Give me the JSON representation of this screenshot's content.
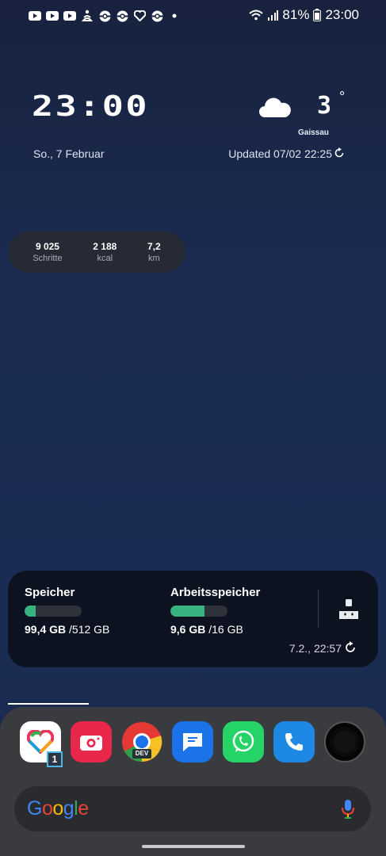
{
  "status_bar": {
    "notification_icons": [
      "youtube-icon",
      "youtube-icon",
      "youtube-icon",
      "meditation-icon",
      "pokemon-icon",
      "pokemon-icon",
      "heart-pulse-icon",
      "pokemon-icon",
      "dot-icon"
    ],
    "battery": "81%",
    "time": "23:00"
  },
  "clock_widget": {
    "time": "23:00",
    "date": "So., 7 Februar",
    "temperature": "3",
    "degree": "°",
    "location": "Gaissau",
    "updated": "Updated 07/02 22:25"
  },
  "health_widget": {
    "stats": [
      {
        "value": "9 025",
        "label": "Schritte"
      },
      {
        "value": "2 188",
        "label": "kcal"
      },
      {
        "value": "7,2",
        "label": "km"
      }
    ]
  },
  "storage_widget": {
    "storage": {
      "title": "Speicher",
      "used": "99,4 GB",
      "total": "/512 GB",
      "fraction": 0.19
    },
    "ram": {
      "title": "Arbeitsspeicher",
      "used": "9,6 GB",
      "total": "/16 GB",
      "fraction": 0.6
    },
    "timestamp": "7.2., 22:57"
  },
  "dock": {
    "apps": [
      "health-app-icon",
      "camera-app-icon",
      "chrome-dev-app-icon",
      "messages-app-icon",
      "whatsapp-app-icon",
      "phone-app-icon",
      "camera-shortcut-icon"
    ],
    "health_badge": "1",
    "chrome_badge": "DEV",
    "search_logo": "Google"
  },
  "colors": {
    "accent_green": "#36b37e",
    "wallpaper": "#1b2c54"
  }
}
